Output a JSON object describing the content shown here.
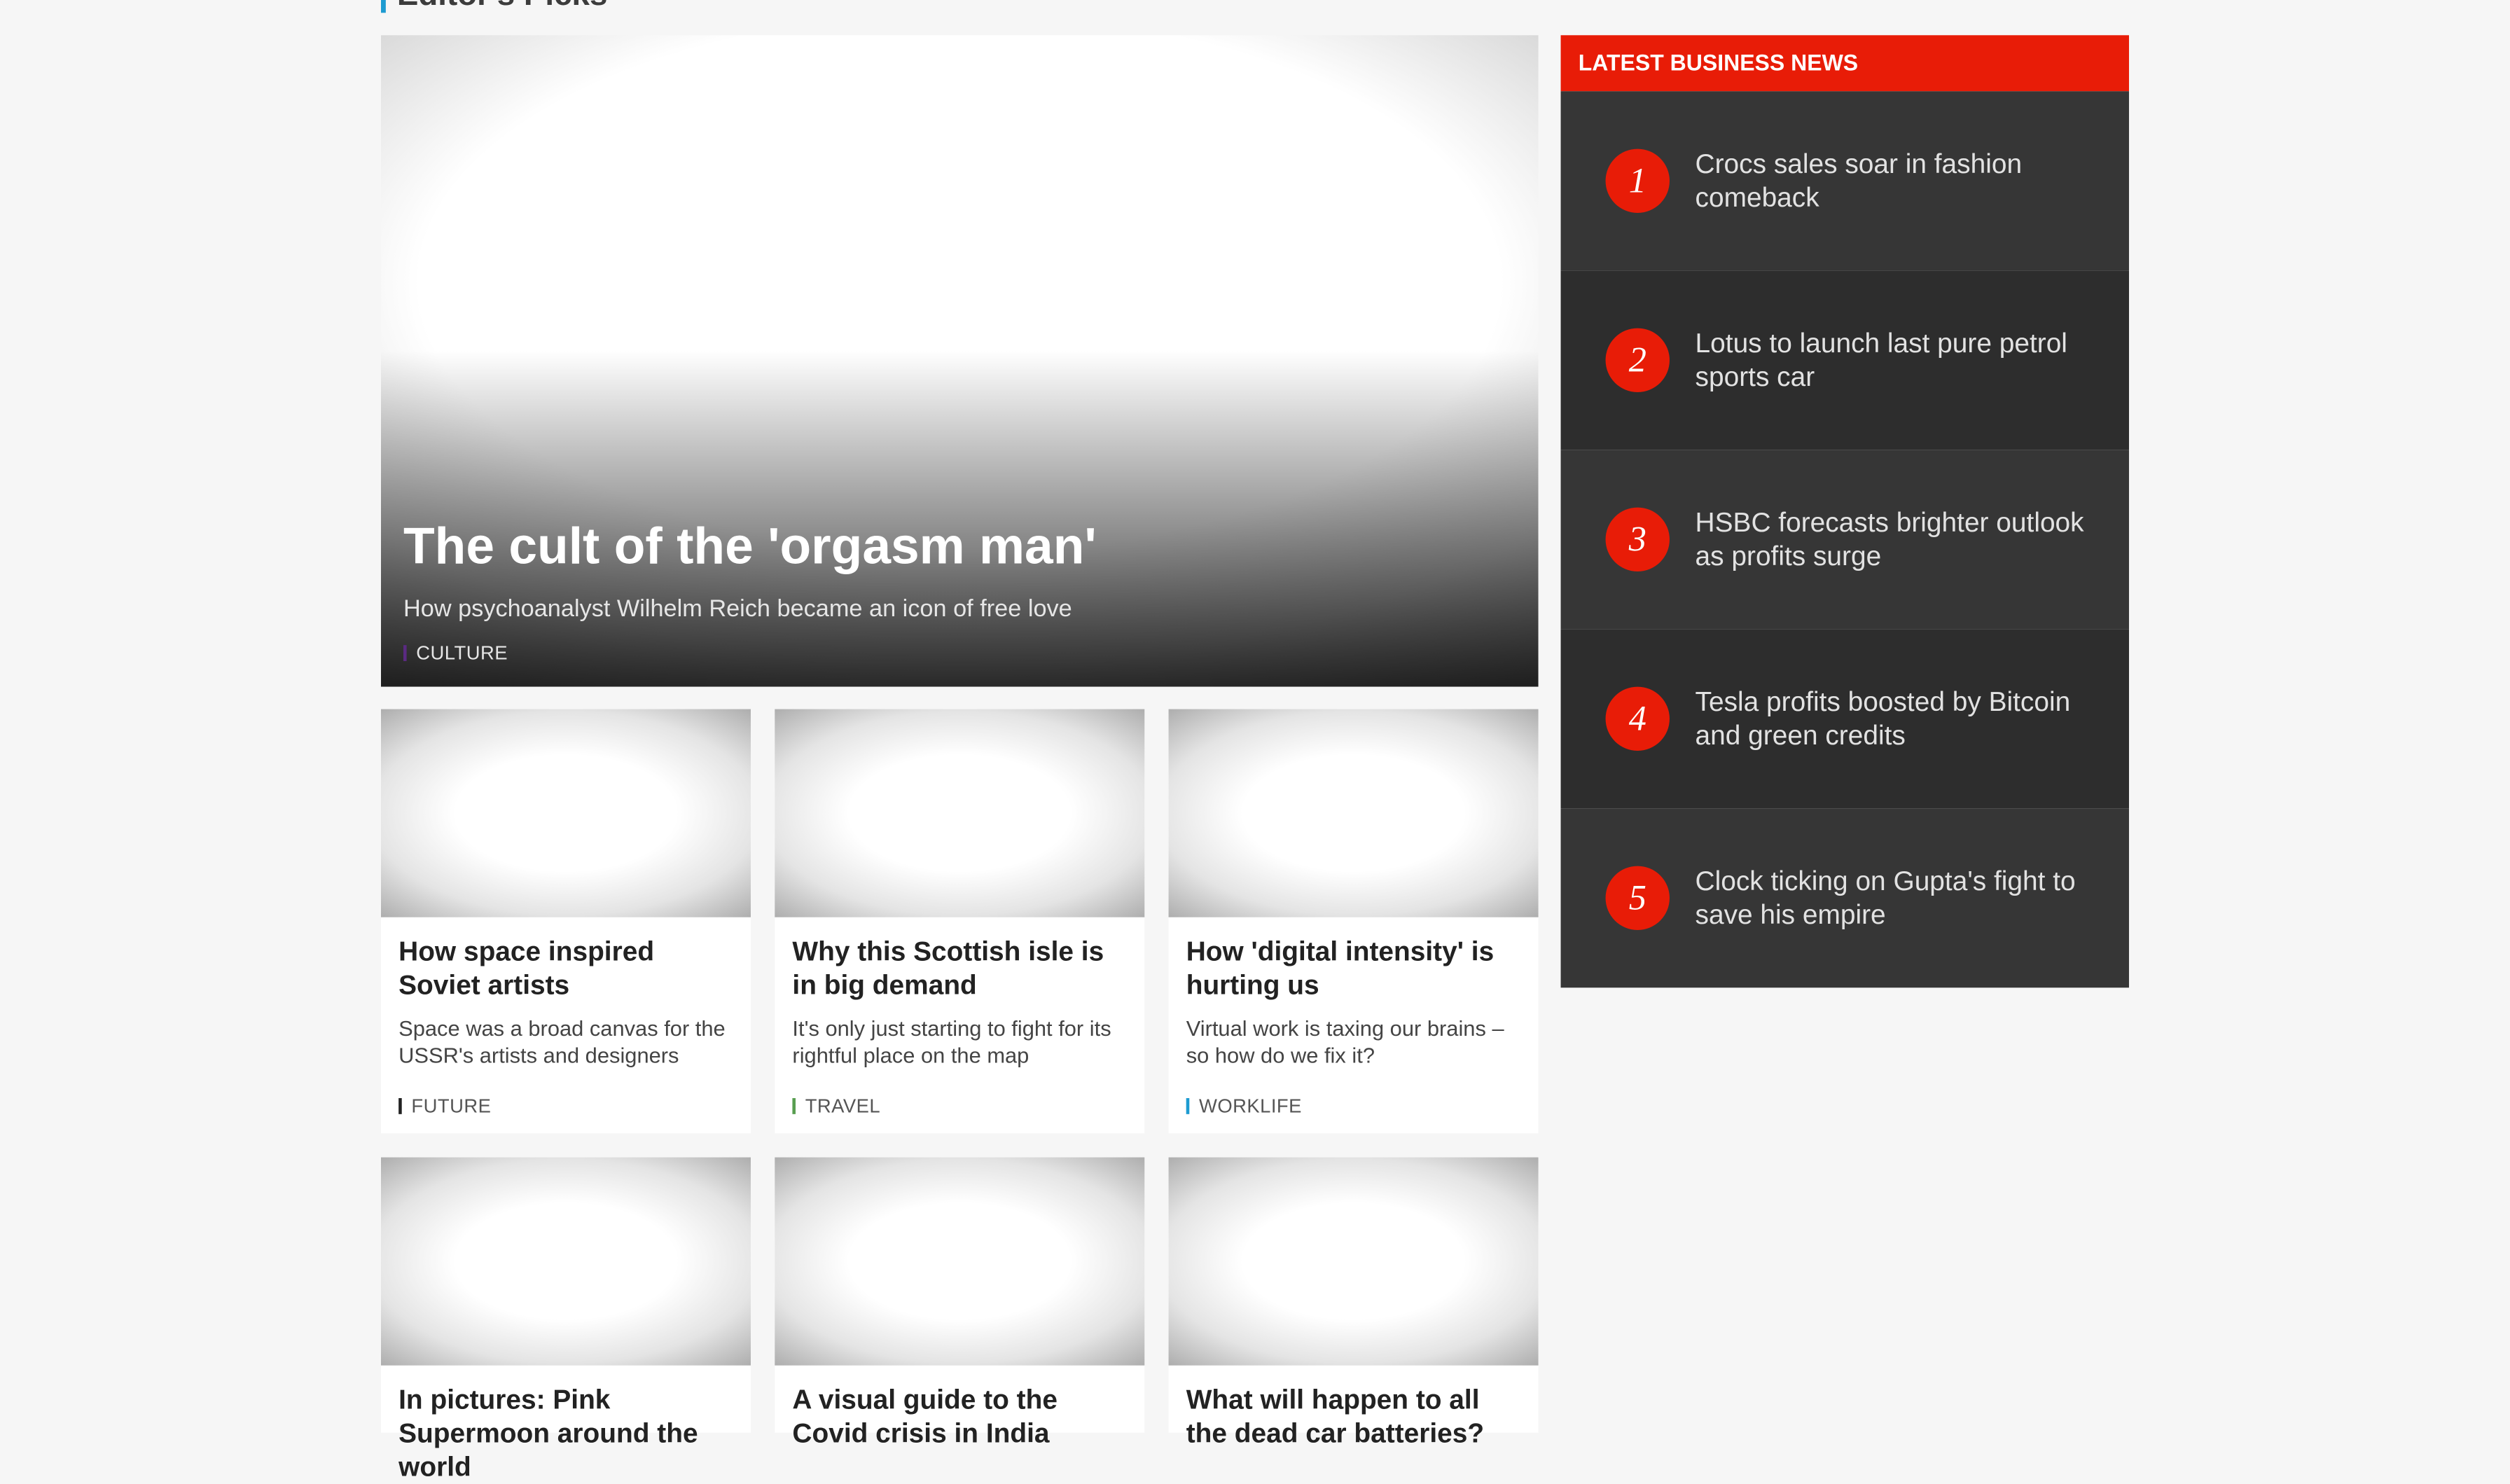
{
  "section": {
    "title": "Editor's Picks"
  },
  "hero": {
    "title": "The cult of the 'orgasm man'",
    "summary": "How psychoanalyst Wilhelm Reich became an icon of free love",
    "tag": "CULTURE"
  },
  "cards": [
    {
      "title": "How space inspired Soviet artists",
      "summary": "Space was a broad canvas for the USSR's artists and designers",
      "tag": "FUTURE"
    },
    {
      "title": "Why this Scottish isle is in big demand",
      "summary": "It's only just starting to fight for its rightful place on the map",
      "tag": "TRAVEL"
    },
    {
      "title": "How 'digital intensity' is hurting us",
      "summary": "Virtual work is taxing our brains – so how do we fix it?",
      "tag": "WORKLIFE"
    },
    {
      "title": "In pictures: Pink Supermoon around the world"
    },
    {
      "title": "A visual guide to the Covid crisis in India"
    },
    {
      "title": "What will happen to all the dead car batteries?"
    }
  ],
  "sidebar": {
    "title": "LATEST BUSINESS NEWS",
    "items": [
      {
        "num": "1",
        "title": "Crocs sales soar in fashion comeback"
      },
      {
        "num": "2",
        "title": "Lotus to launch last pure petrol sports car"
      },
      {
        "num": "3",
        "title": "HSBC forecasts brighter outlook as profits surge"
      },
      {
        "num": "4",
        "title": "Tesla profits boosted by Bitcoin and green credits"
      },
      {
        "num": "5",
        "title": "Clock ticking on Gupta's fight to save his empire"
      }
    ]
  },
  "colors": {
    "accent_red": "#e81c07",
    "culture": "#5a2a82",
    "travel": "#589e50",
    "worklife": "#1d9bd1",
    "future": "#222222"
  }
}
